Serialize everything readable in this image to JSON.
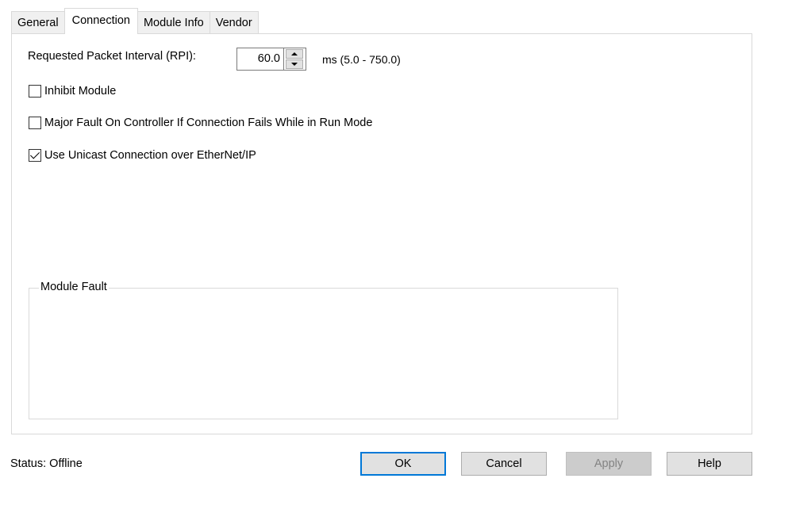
{
  "tabs": [
    {
      "label": "General",
      "active": false
    },
    {
      "label": "Connection",
      "active": true
    },
    {
      "label": "Module Info",
      "active": false
    },
    {
      "label": "Vendor",
      "active": false
    }
  ],
  "connection": {
    "rpi_label": "Requested Packet Interval (RPI):",
    "rpi_value": "60.0",
    "rpi_range": "ms (5.0 - 750.0)",
    "options": [
      {
        "label": "Inhibit Module",
        "checked": false
      },
      {
        "label": "Major Fault On Controller If Connection Fails While in Run Mode",
        "checked": false
      },
      {
        "label": "Use Unicast Connection over EtherNet/IP",
        "checked": true
      }
    ],
    "module_fault_title": "Module Fault"
  },
  "status": {
    "text": "Status:  Offline"
  },
  "buttons": {
    "ok": "OK",
    "cancel": "Cancel",
    "apply": "Apply",
    "help": "Help"
  },
  "colors": {
    "accent": "#0078d7",
    "button_bg": "#e1e1e1",
    "disabled_bg": "#cccccc",
    "border": "#d9d9d9"
  }
}
